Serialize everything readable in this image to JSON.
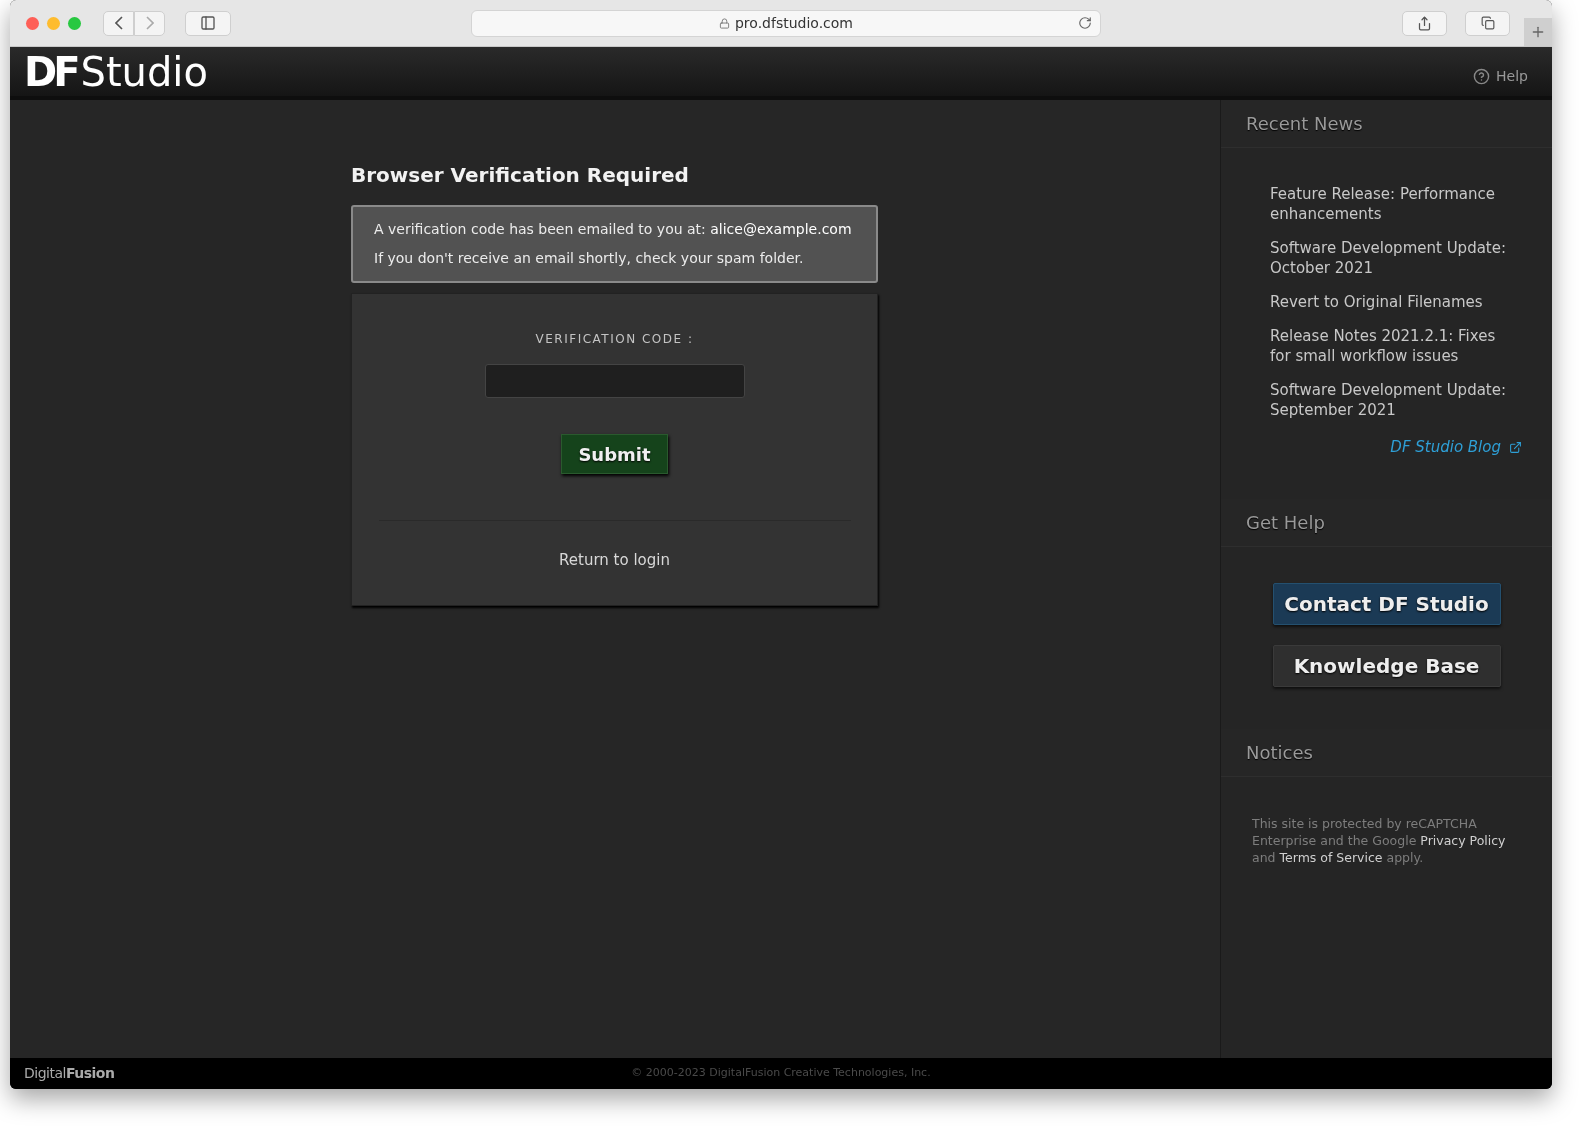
{
  "browser": {
    "url": "pro.dfstudio.com"
  },
  "header": {
    "logo_mark": "DF",
    "logo_word": "Studio",
    "help": "Help"
  },
  "verification": {
    "title": "Browser Verification Required",
    "message": {
      "text": "A verification code has been emailed to you at:",
      "email": "alice@example.com"
    },
    "hint": "If you don't receive an email shortly, check your spam folder.",
    "field_label": "VERIFICATION CODE :",
    "submit": "Submit",
    "return_link": "Return to login"
  },
  "sidebar": {
    "sections": [
      {
        "kind": "news",
        "title": "Recent News",
        "items": [
          "Feature Release: Performance enhancements",
          "Software Development Update: October 2021",
          "Revert to Original Filenames",
          "Release Notes 2021.2.1: Fixes for small workflow issues",
          "Software Development Update: September 2021"
        ],
        "blog_link": "DF Studio Blog"
      },
      {
        "kind": "help",
        "title": "Get Help",
        "buttons": [
          {
            "label": "Contact DF Studio",
            "primary": true
          },
          {
            "label": "Knowledge Base",
            "primary": false
          }
        ]
      },
      {
        "kind": "notices",
        "title": "Notices",
        "segments": [
          {
            "kind": "text",
            "text": "This site is protected by reCAPTCHA Enterprise and the Google"
          },
          {
            "kind": "link",
            "text": "Privacy Policy"
          },
          {
            "kind": "text",
            "text": "and"
          },
          {
            "kind": "link",
            "text": "Terms of Service"
          },
          {
            "kind": "text",
            "text": "apply."
          }
        ]
      }
    ]
  },
  "footer": {
    "logo": "Digital**Fusion**",
    "copyright": "© 2000-2023 DigitalFusion Creative Technologies, Inc."
  }
}
